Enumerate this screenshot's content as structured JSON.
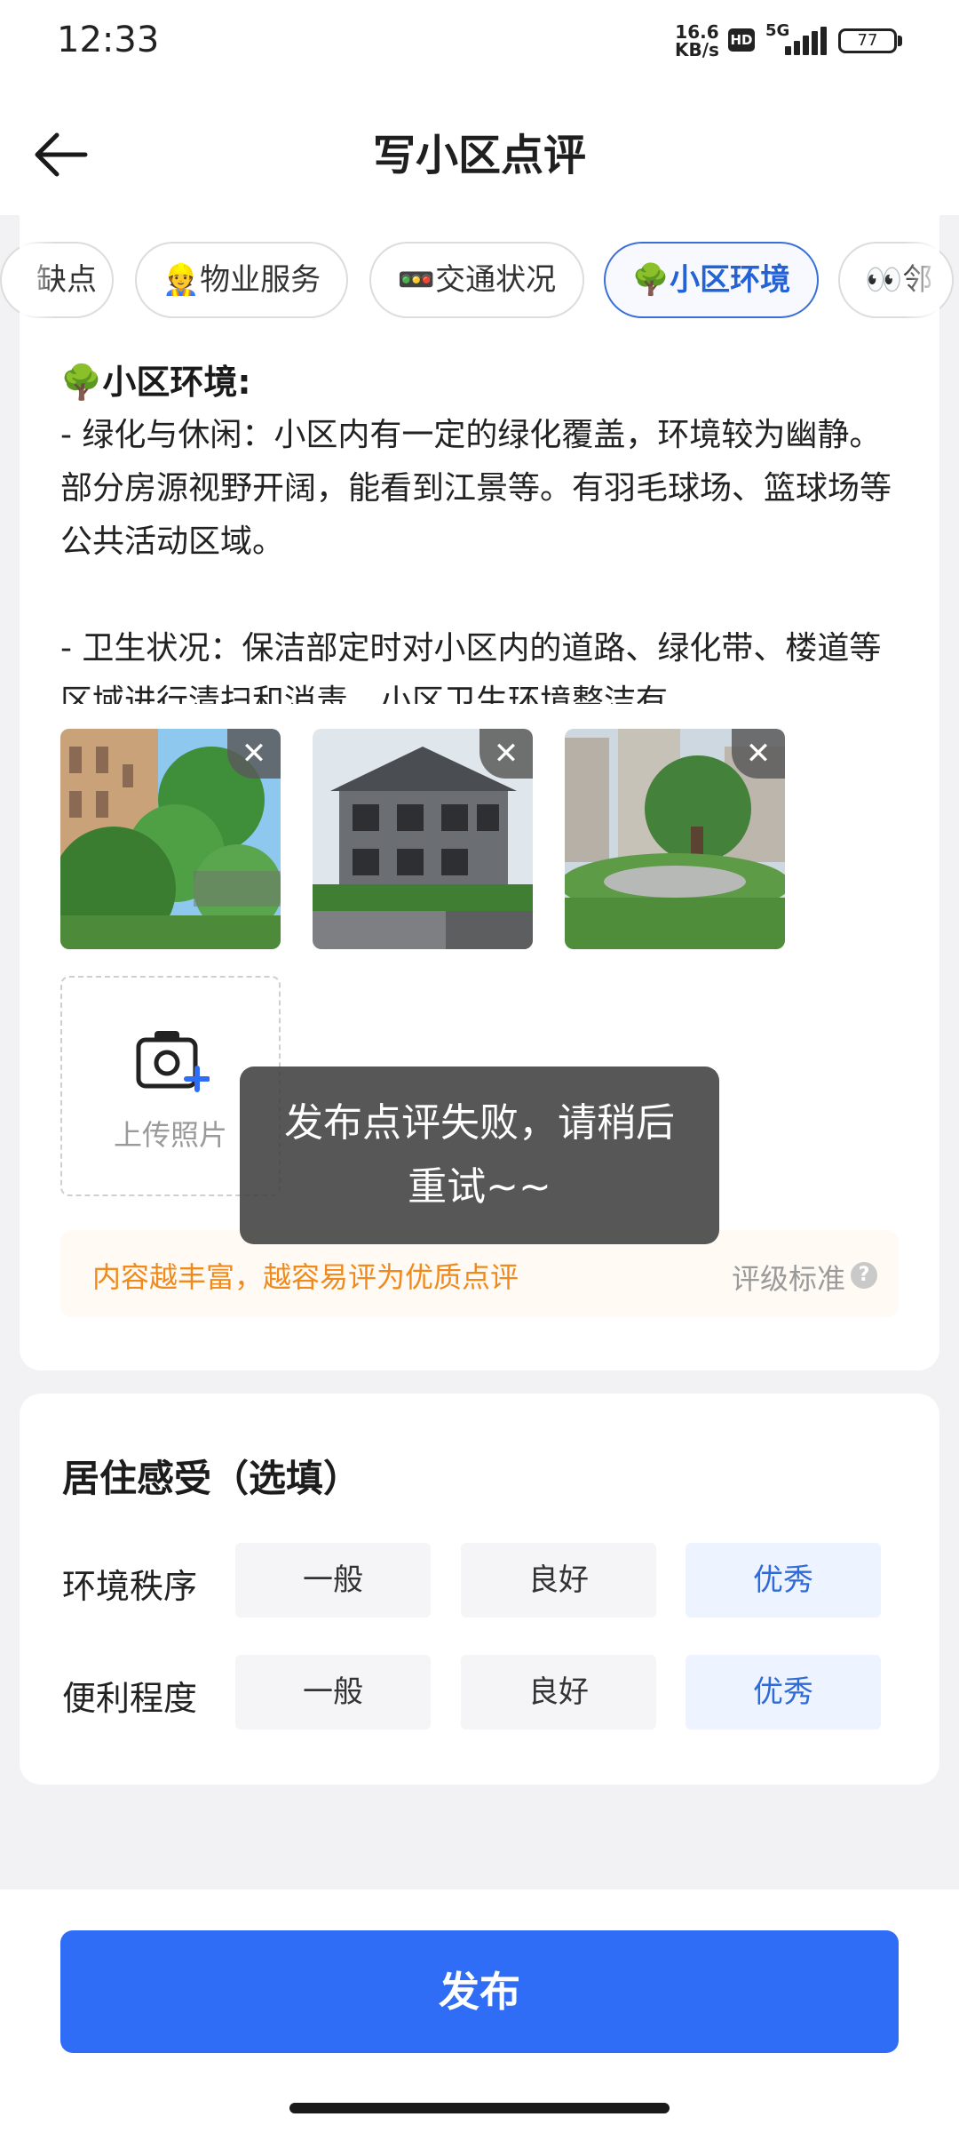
{
  "status_bar": {
    "time": "12:33",
    "speed_value": "16.6",
    "speed_unit": "KB/s",
    "hd_badge": "HD",
    "network": "5G",
    "battery": "77"
  },
  "header": {
    "title": "写小区点评",
    "back_icon": "arrow-left-icon"
  },
  "tabs": [
    {
      "label": "缺点",
      "emoji": "",
      "active": false
    },
    {
      "label": "物业服务",
      "emoji": "👷",
      "active": false
    },
    {
      "label": "交通状况",
      "emoji": "🚥",
      "active": false
    },
    {
      "label": "小区环境",
      "emoji": "🌳",
      "active": true
    },
    {
      "label": "邻",
      "emoji": "👀",
      "active": false
    }
  ],
  "review": {
    "heading_emoji": "🌳",
    "heading": "小区环境:",
    "para1": "- 绿化与休闲：小区内有一定的绿化覆盖，环境较为幽静。部分房源视野开阔，能看到江景等。有羽毛球场、篮球场等公共活动区域。",
    "para2": "- 卫生状况：保洁部定时对小区内的道路、绿化带、楼道等区域进行清扫和消毒，小区卫生环境整洁有"
  },
  "photos": [
    {
      "name": "photo-trees-buildings"
    },
    {
      "name": "photo-villa"
    },
    {
      "name": "photo-garden"
    }
  ],
  "upload": {
    "label": "上传照片",
    "icon": "camera-plus-icon"
  },
  "tip": {
    "text": "内容越丰富，越容易评为优质点评",
    "link": "评级标准",
    "help_icon": "?"
  },
  "toast": {
    "line1": "发布点评失败，请稍后",
    "line2": "重试~~"
  },
  "living": {
    "title": "居住感受（选填）",
    "rows": [
      {
        "label": "环境秩序",
        "options": [
          "一般",
          "良好",
          "优秀"
        ],
        "selected": "优秀"
      },
      {
        "label": "便利程度",
        "options": [
          "一般",
          "良好",
          "优秀"
        ],
        "selected": "优秀"
      }
    ]
  },
  "publish_button": "发布",
  "colors": {
    "accent": "#2f6df6",
    "tip_orange": "#f08a1c"
  }
}
